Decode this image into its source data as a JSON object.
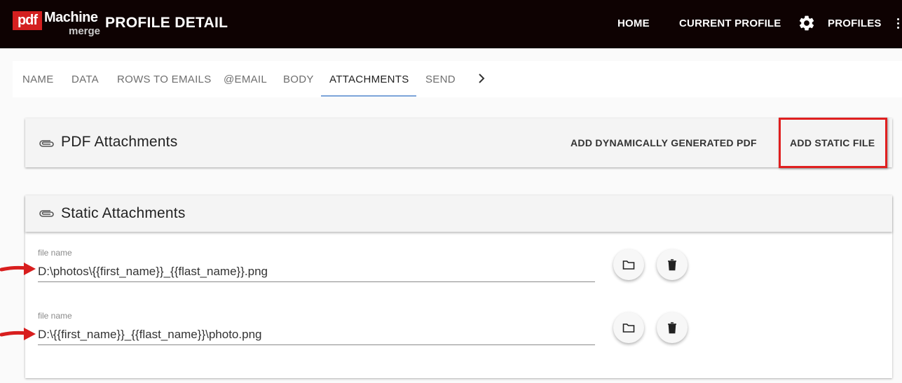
{
  "header": {
    "logo": {
      "pdf": "pdf",
      "machine": "Machine",
      "merge": "merge"
    },
    "title": "PROFILE DETAIL",
    "nav": {
      "home": "HOME",
      "current_profile": "CURRENT PROFILE",
      "profiles": "PROFILES"
    },
    "icons": {
      "settings": "gear-icon",
      "more": "more-vert-icon"
    }
  },
  "tabs": [
    {
      "label": "NAME"
    },
    {
      "label": "DATA"
    },
    {
      "label": "ROWS TO EMAILS"
    },
    {
      "label": "@EMAIL"
    },
    {
      "label": "BODY"
    },
    {
      "label": "ATTACHMENTS",
      "active": true
    },
    {
      "label": "SEND"
    }
  ],
  "pdf_attachments": {
    "title": "PDF Attachments",
    "add_dynamic_label": "ADD DYNAMICALLY GENERATED PDF",
    "add_static_label": "ADD STATIC FILE"
  },
  "static_attachments": {
    "title": "Static Attachments",
    "files": [
      {
        "label": "file name",
        "value": "D:\\photos\\{{first_name}}_{{flast_name}}.png"
      },
      {
        "label": "file name",
        "value": "D:\\{{first_name}}_{{flast_name}}\\photo.png"
      }
    ]
  },
  "colors": {
    "header_bg": "#0e0202",
    "highlight": "#e01f1f",
    "tab_underline": "#7ba3d8",
    "logo_red": "#d32020"
  }
}
